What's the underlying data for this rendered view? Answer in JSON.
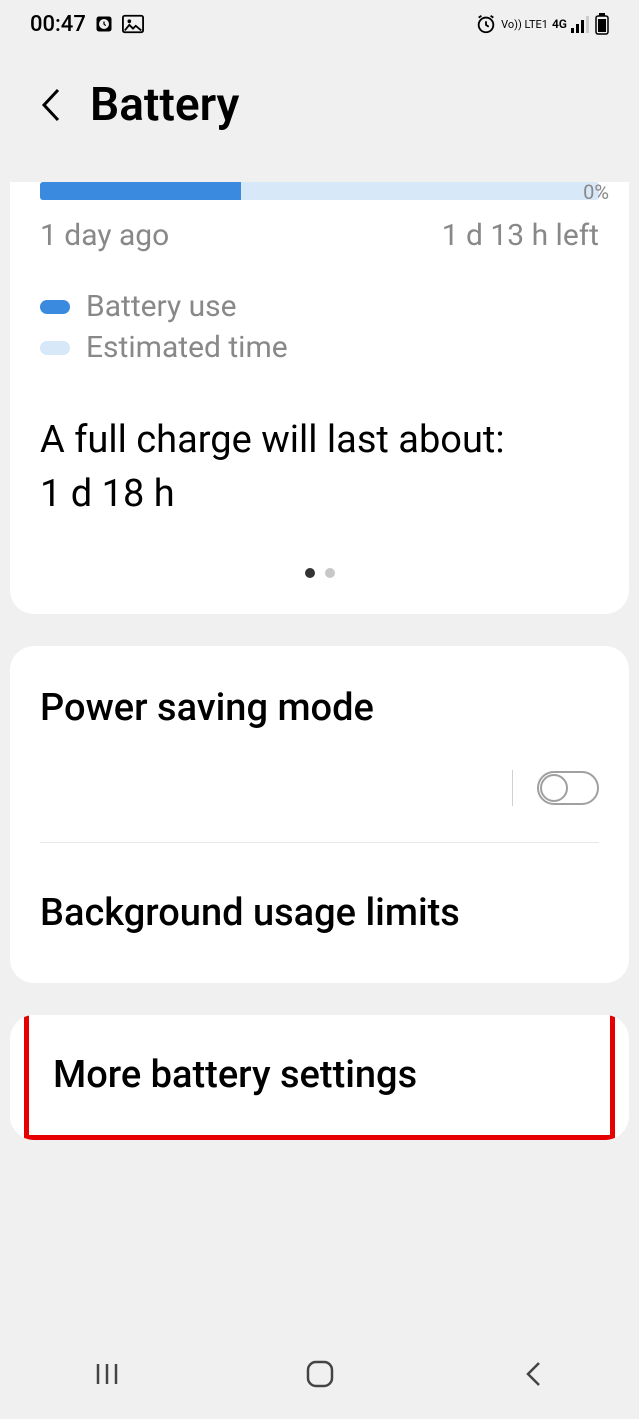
{
  "status": {
    "time": "00:47",
    "left_icons": {
      "clock": "clock-icon",
      "image": "image-icon"
    },
    "right_icons": {
      "alarm": "alarm-icon",
      "volte": "Vo)) LTE1",
      "network": "4G",
      "signal": "signal-icon",
      "battery": "battery-icon"
    }
  },
  "header": {
    "title": "Battery"
  },
  "battery": {
    "percent_label": "0%",
    "left_label": "1 day ago",
    "right_label": "1 d 13 h left",
    "legend": {
      "use": "Battery use",
      "est": "Estimated time"
    },
    "full_charge_label": "A full charge will last about:",
    "full_charge_value": "1 d 18 h"
  },
  "settings": {
    "power_saving": "Power saving mode",
    "bg_limits": "Background usage limits",
    "more": "More battery settings"
  }
}
